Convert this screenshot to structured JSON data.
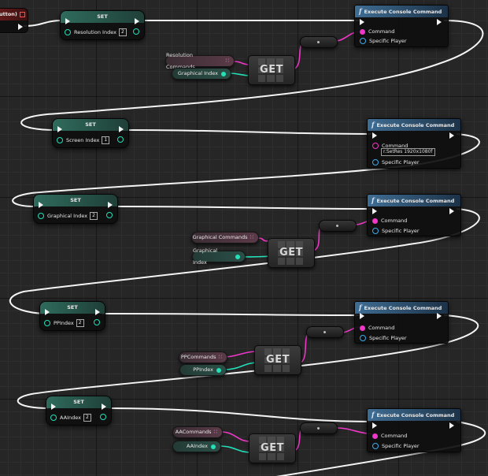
{
  "event_node": {
    "title": "utton)"
  },
  "set_nodes": [
    {
      "title": "SET",
      "var": "Resolution Index",
      "value": "2"
    },
    {
      "title": "SET",
      "var": "Screen Index",
      "value": "1"
    },
    {
      "title": "SET",
      "var": "Graphical Index",
      "value": "2"
    },
    {
      "title": "SET",
      "var": "PPIndex",
      "value": "2"
    },
    {
      "title": "SET",
      "var": "AAIndex",
      "value": "2"
    }
  ],
  "exec_nodes": [
    {
      "title": "Execute Console Command",
      "command": "Command",
      "player": "Specific Player"
    },
    {
      "title": "Execute Console Command",
      "command": "Command",
      "command_value": "r.SetRes 1920x1080f",
      "player": "Specific Player"
    },
    {
      "title": "Execute Console Command",
      "command": "Command",
      "player": "Specific Player"
    },
    {
      "title": "Execute Console Command",
      "command": "Command",
      "player": "Specific Player"
    },
    {
      "title": "Execute Console Command",
      "command": "Command",
      "player": "Specific Player"
    }
  ],
  "get_nodes": [
    {
      "label": "GET",
      "array": "Resolution Commands",
      "index": "Graphical Index"
    },
    {
      "label": "GET",
      "array": "Graphical Commands",
      "index": "Graphical Index"
    },
    {
      "label": "GET",
      "array": "PPCommands",
      "index": "PPIndex"
    },
    {
      "label": "GET",
      "array": "AACommands",
      "index": "AAIndex"
    }
  ],
  "colors": {
    "exec_wire": "#ffffff",
    "string_wire": "#f038c8",
    "int_wire": "#23e0b8",
    "set_header": "#2f6b5c",
    "exec_header": "#3f6d93",
    "event_header": "#6a1c1c",
    "pin_blue": "#3ea9ea"
  },
  "icons": [
    "function-icon",
    "exec-pin-icon",
    "array-grid-icon",
    "data-pin-icon"
  ]
}
